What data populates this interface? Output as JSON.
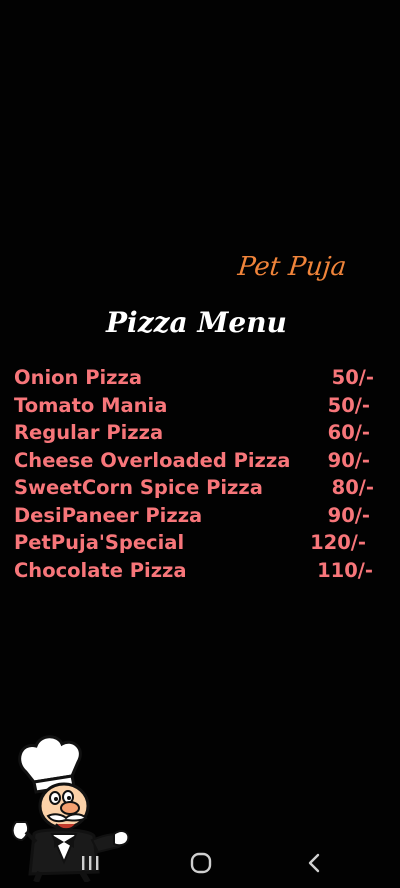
{
  "menu_card": {
    "brand": "Pet Puja",
    "title": "Pizza Menu",
    "items": [
      {
        "name": "Onion Pizza",
        "price": "50/-"
      },
      {
        "name": "Tomato Mania",
        "price": "50/-"
      },
      {
        "name": "Regular Pizza",
        "price": "60/-"
      },
      {
        "name": "Cheese Overloaded Pizza",
        "price": "90/-"
      },
      {
        "name": "SweetCorn Spice Pizza",
        "price": "80/-"
      },
      {
        "name": "DesiPaneer Pizza",
        "price": "90/-"
      },
      {
        "name": "PetPuja'Special",
        "price": "120/-"
      },
      {
        "name": "Chocolate Pizza",
        "price": "110/-"
      }
    ]
  },
  "colors": {
    "background": "#020202",
    "brand": "#f0843a",
    "title": "#ffffff",
    "item_text": "#f7767a",
    "nav_icon": "#cfcfcf"
  },
  "illustration": {
    "icon": "chef-mascot-icon"
  },
  "nav_bar": {
    "recents_icon": "recent-apps-icon",
    "home_icon": "home-icon",
    "back_icon": "back-icon"
  }
}
